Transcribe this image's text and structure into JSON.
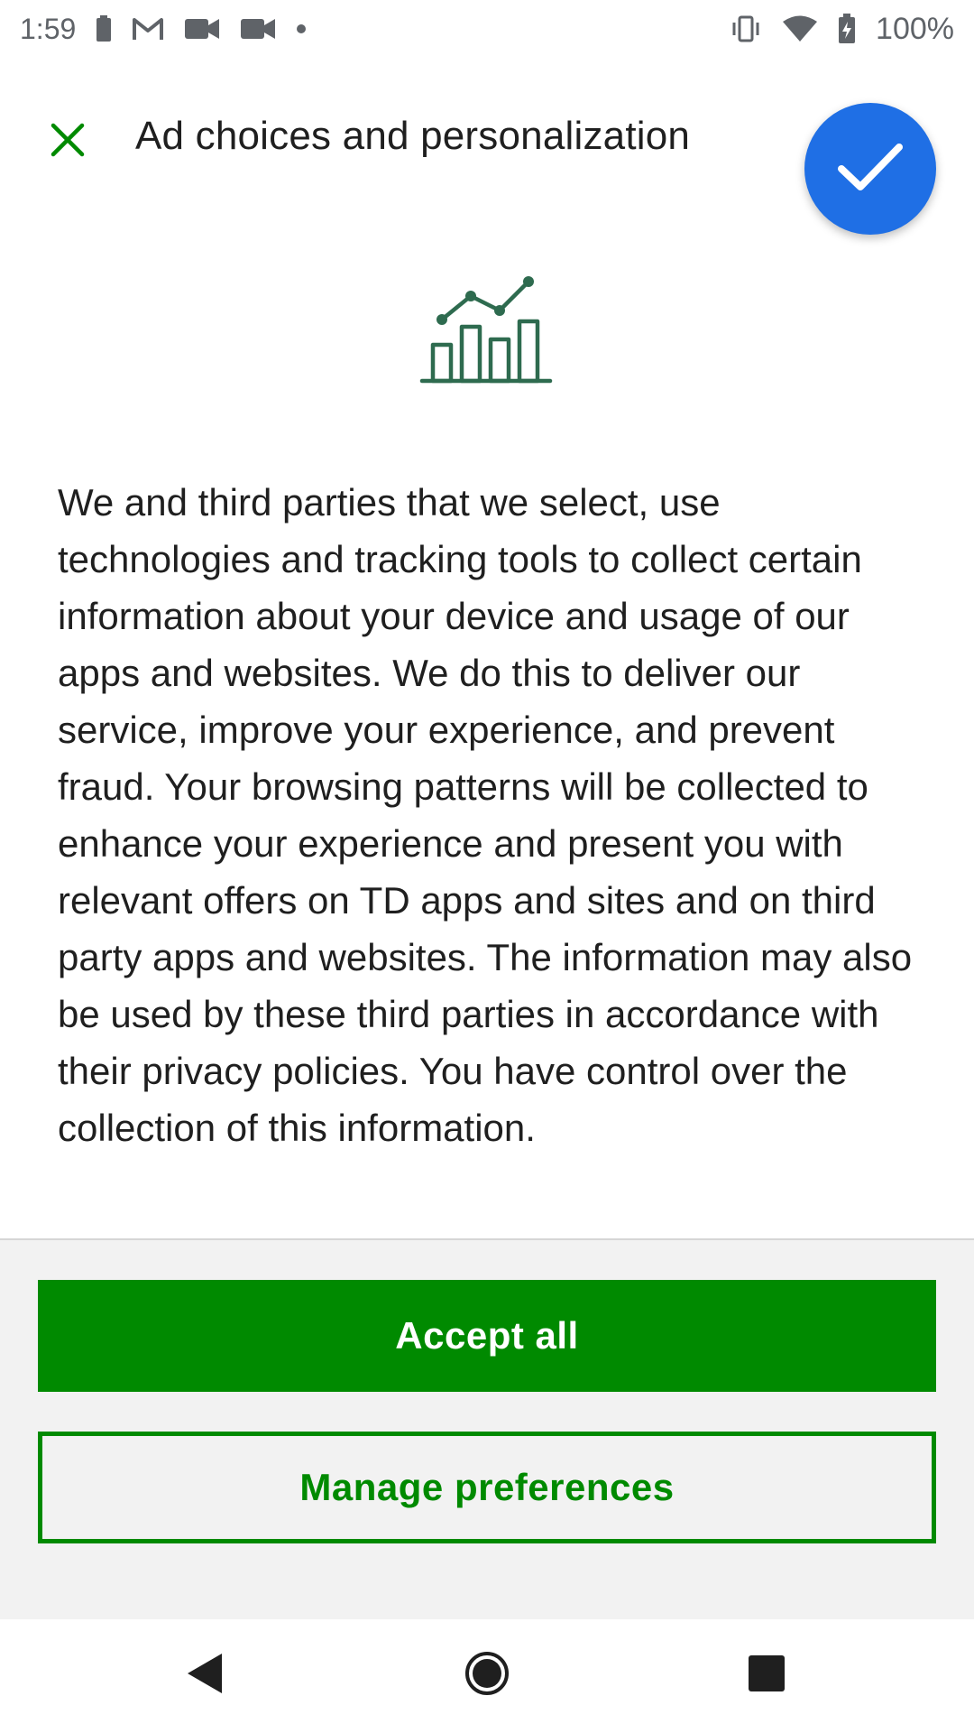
{
  "status_bar": {
    "time": "1:59",
    "battery_percent": "100%",
    "icons": [
      "battery-small-icon",
      "gmail-icon",
      "video-call-icon",
      "video-call-icon",
      "dot-icon",
      "vibrate-icon",
      "wifi-icon",
      "battery-charging-icon"
    ]
  },
  "header": {
    "title": "Ad choices and personalization",
    "close_icon": "close-icon",
    "confirm_icon": "check-icon"
  },
  "illustration": {
    "icon": "analytics-chart-icon",
    "color": "#2e6b4f"
  },
  "content": {
    "body": "We and third parties that we select, use technologies and tracking tools to collect certain information about your device and usage of our apps and websites. We do this to deliver our service, improve your experience, and prevent fraud. Your browsing patterns will be collected to enhance your experience and present you with relevant offers on TD apps and sites and on third party apps and websites. The information may also be used by these third parties in accordance with their privacy policies. You have control over the collection of this information."
  },
  "actions": {
    "accept_label": "Accept all",
    "manage_label": "Manage preferences"
  },
  "nav_bar": {
    "back_icon": "back-icon",
    "home_icon": "home-icon",
    "recents_icon": "recents-icon"
  },
  "colors": {
    "brand_green": "#008a00",
    "fab_blue": "#1f6fe5",
    "panel_bg": "#f2f2f2"
  }
}
